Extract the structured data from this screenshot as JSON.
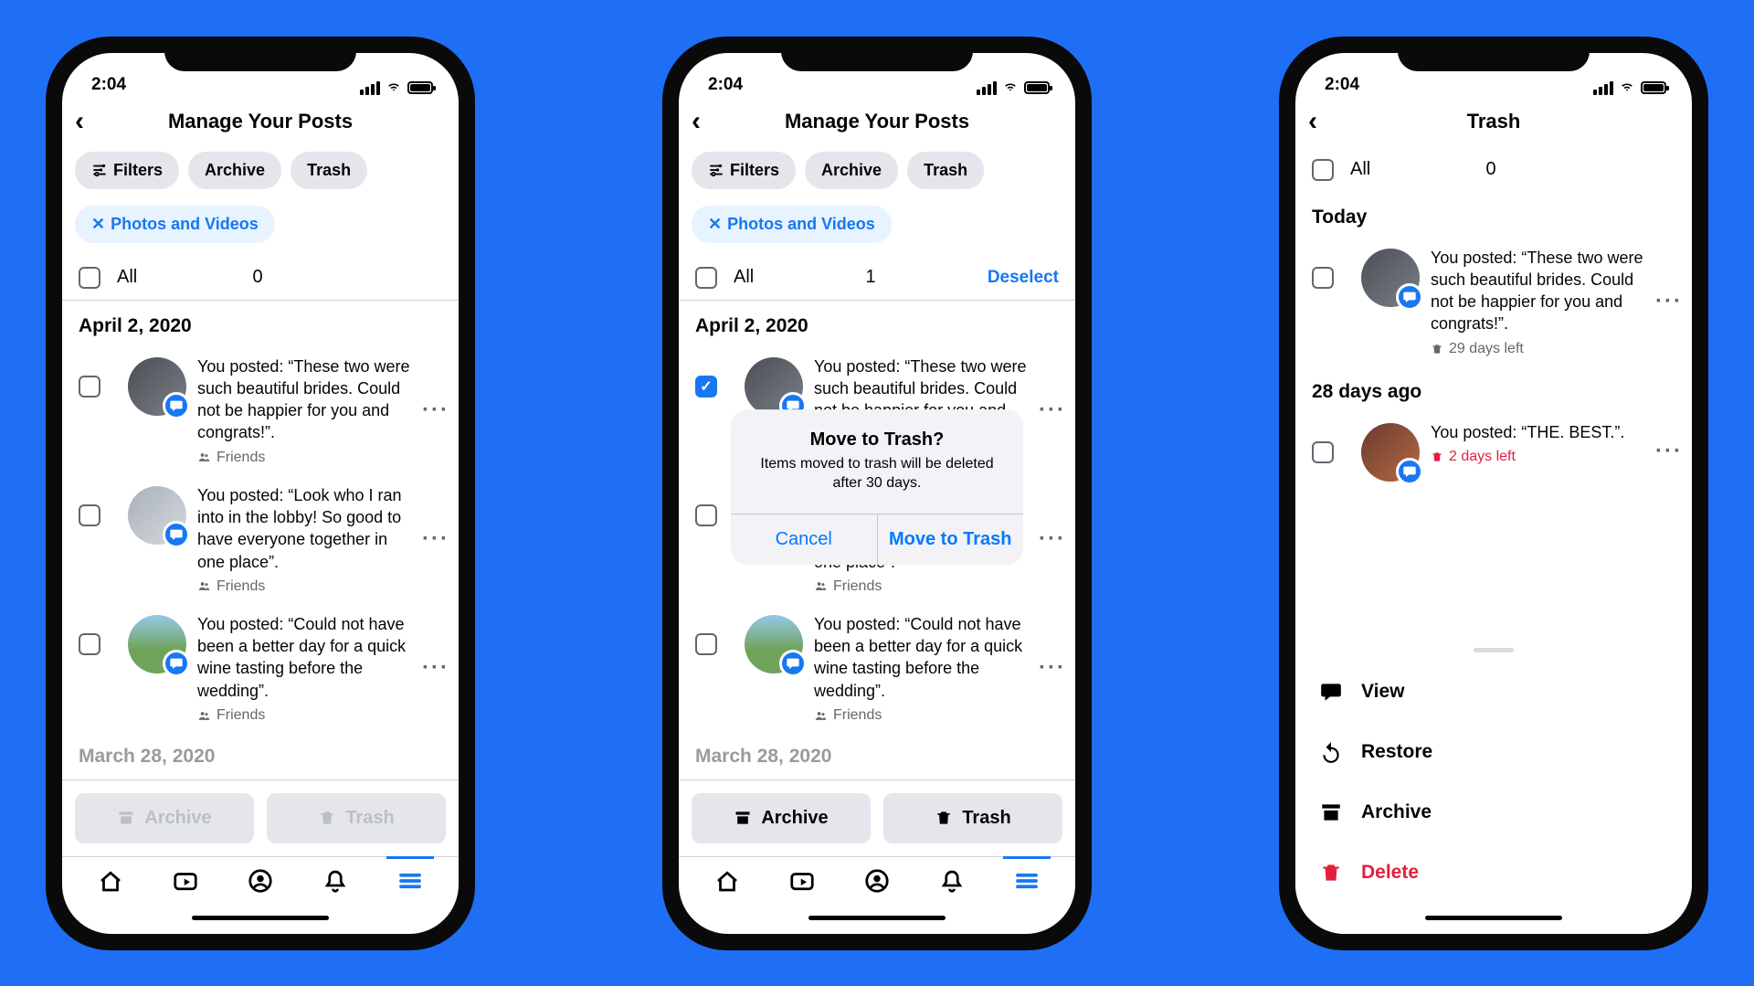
{
  "status_time": "2:04",
  "screen1": {
    "title": "Manage Your Posts",
    "chips": {
      "filters": "Filters",
      "archive": "Archive",
      "trash": "Trash"
    },
    "filter_chip": "Photos and Videos",
    "all_label": "All",
    "all_count": "0",
    "date_header": "April 2, 2020",
    "posts": [
      {
        "text": "You posted: “These two were such beautiful brides. Could not be happier for you and congrats!”.",
        "audience": "Friends"
      },
      {
        "text": "You posted: “Look who I ran into in the lobby! So good to have everyone together in one place”.",
        "audience": "Friends"
      },
      {
        "text": "You posted: “Could not have been a better day for a quick wine tasting before the wedding”.",
        "audience": "Friends"
      }
    ],
    "bottom": {
      "archive": "Archive",
      "trash": "Trash"
    }
  },
  "screen2": {
    "title": "Manage Your Posts",
    "chips": {
      "filters": "Filters",
      "archive": "Archive",
      "trash": "Trash"
    },
    "filter_chip": "Photos and Videos",
    "all_label": "All",
    "all_count": "1",
    "deselect": "Deselect",
    "date_header": "April 2, 2020",
    "dialog": {
      "title": "Move to Trash?",
      "message": "Items moved to trash will be deleted after 30 days.",
      "cancel": "Cancel",
      "confirm": "Move to Trash"
    },
    "bottom": {
      "archive": "Archive",
      "trash": "Trash"
    }
  },
  "screen3": {
    "title": "Trash",
    "all_label": "All",
    "all_count": "0",
    "section1": "Today",
    "post1": {
      "text": "You posted: “These two were such beautiful brides. Could not be happier for you and congrats!”.",
      "meta": "29 days left"
    },
    "section2": "28 days ago",
    "post2": {
      "text": "You posted: “THE. BEST.”.",
      "meta": "2 days left"
    },
    "sheet": {
      "view": "View",
      "restore": "Restore",
      "archive": "Archive",
      "delete": "Delete"
    }
  }
}
